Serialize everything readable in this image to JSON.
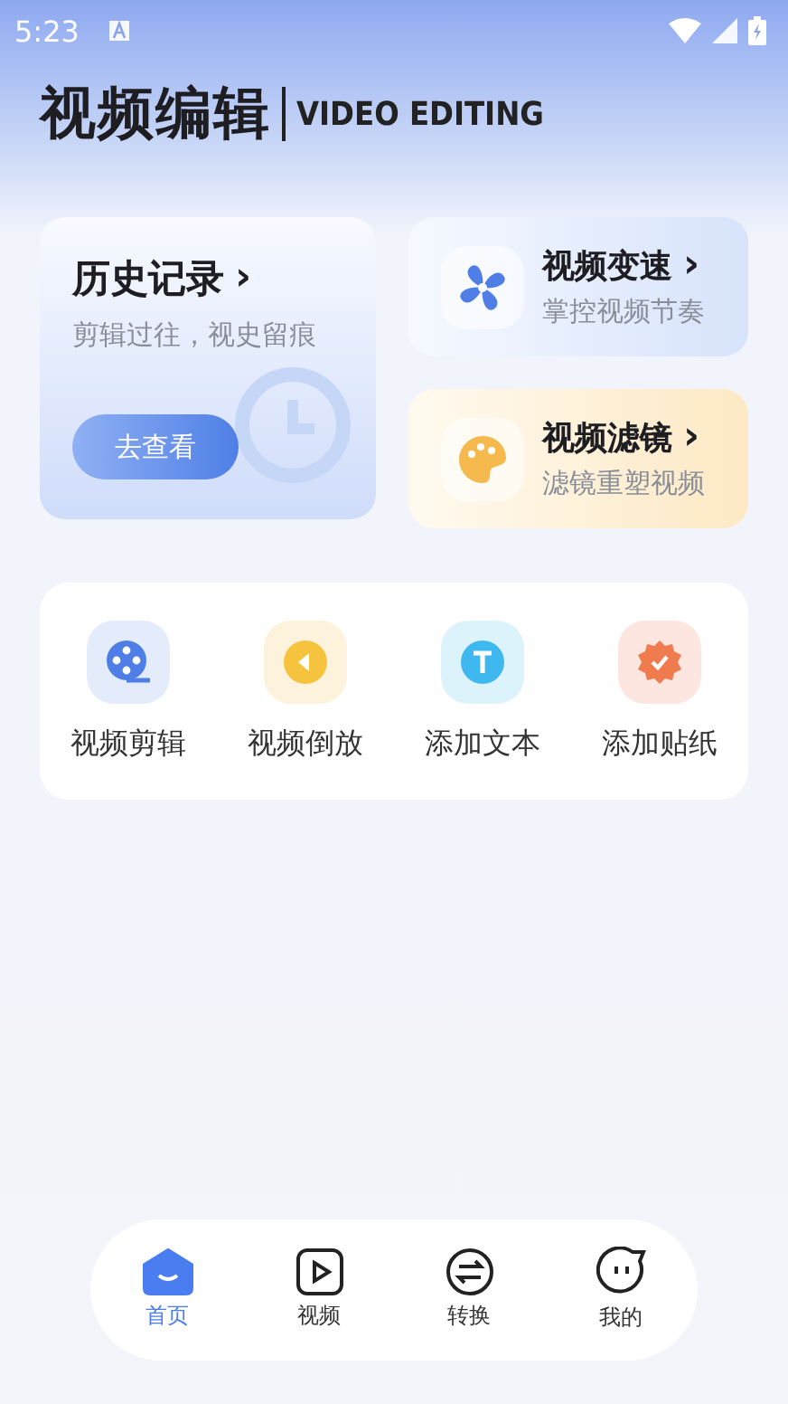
{
  "status_bar": {
    "time": "5:23"
  },
  "header": {
    "title": "视频编辑",
    "subtitle": "VIDEO EDITING"
  },
  "history_card": {
    "title": "历史记录",
    "chevron": "›",
    "subtitle": "剪辑过往，视史留痕",
    "button": "去查看"
  },
  "feature_cards": [
    {
      "kind": "speed",
      "title": "视频变速",
      "chevron": "›",
      "subtitle": "掌控视频节奏"
    },
    {
      "kind": "filter",
      "title": "视频滤镜",
      "chevron": "›",
      "subtitle": "滤镜重塑视频"
    }
  ],
  "tools": [
    {
      "kind": "edit",
      "label": "视频剪辑"
    },
    {
      "kind": "reverse",
      "label": "视频倒放"
    },
    {
      "kind": "text",
      "label": "添加文本"
    },
    {
      "kind": "sticker",
      "label": "添加贴纸"
    }
  ],
  "bottom_nav": [
    {
      "kind": "home",
      "label": "首页",
      "selected": true
    },
    {
      "kind": "video",
      "label": "视频",
      "selected": false
    },
    {
      "kind": "convert",
      "label": "转换",
      "selected": false
    },
    {
      "kind": "mine",
      "label": "我的",
      "selected": false
    }
  ]
}
